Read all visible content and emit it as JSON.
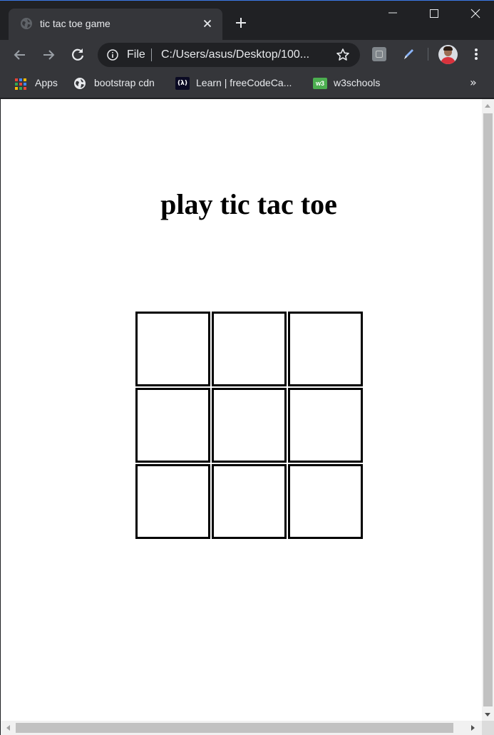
{
  "browser": {
    "tab_title": "tic tac toe game",
    "omnibox_scheme": "File",
    "url": "C:/Users/asus/Desktop/100...",
    "bookmarks": [
      {
        "label": "Apps",
        "icon": "apps-grid-icon"
      },
      {
        "label": "bootstrap cdn",
        "icon": "globe-icon"
      },
      {
        "label": "Learn | freeCodeCa...",
        "icon": "freecodecamp-icon"
      },
      {
        "label": "w3schools",
        "icon": "w3schools-icon"
      }
    ],
    "more_bookmarks": "»",
    "icons": [
      "globe-icon",
      "close-icon",
      "plus-icon",
      "minimize-icon",
      "maximize-icon",
      "window-close-icon",
      "back-arrow-icon",
      "forward-arrow-icon",
      "reload-icon",
      "info-icon",
      "star-icon",
      "extension-icon",
      "pen-icon",
      "avatar",
      "more-vert-icon"
    ]
  },
  "page": {
    "title": "play tic tac toe",
    "board": [
      "",
      "",
      "",
      "",
      "",
      "",
      "",
      "",
      ""
    ]
  },
  "colors": {
    "frame": "#202124",
    "toolbar": "#35363a",
    "page_bg": "#ffffff",
    "cell_border": "#000000"
  }
}
